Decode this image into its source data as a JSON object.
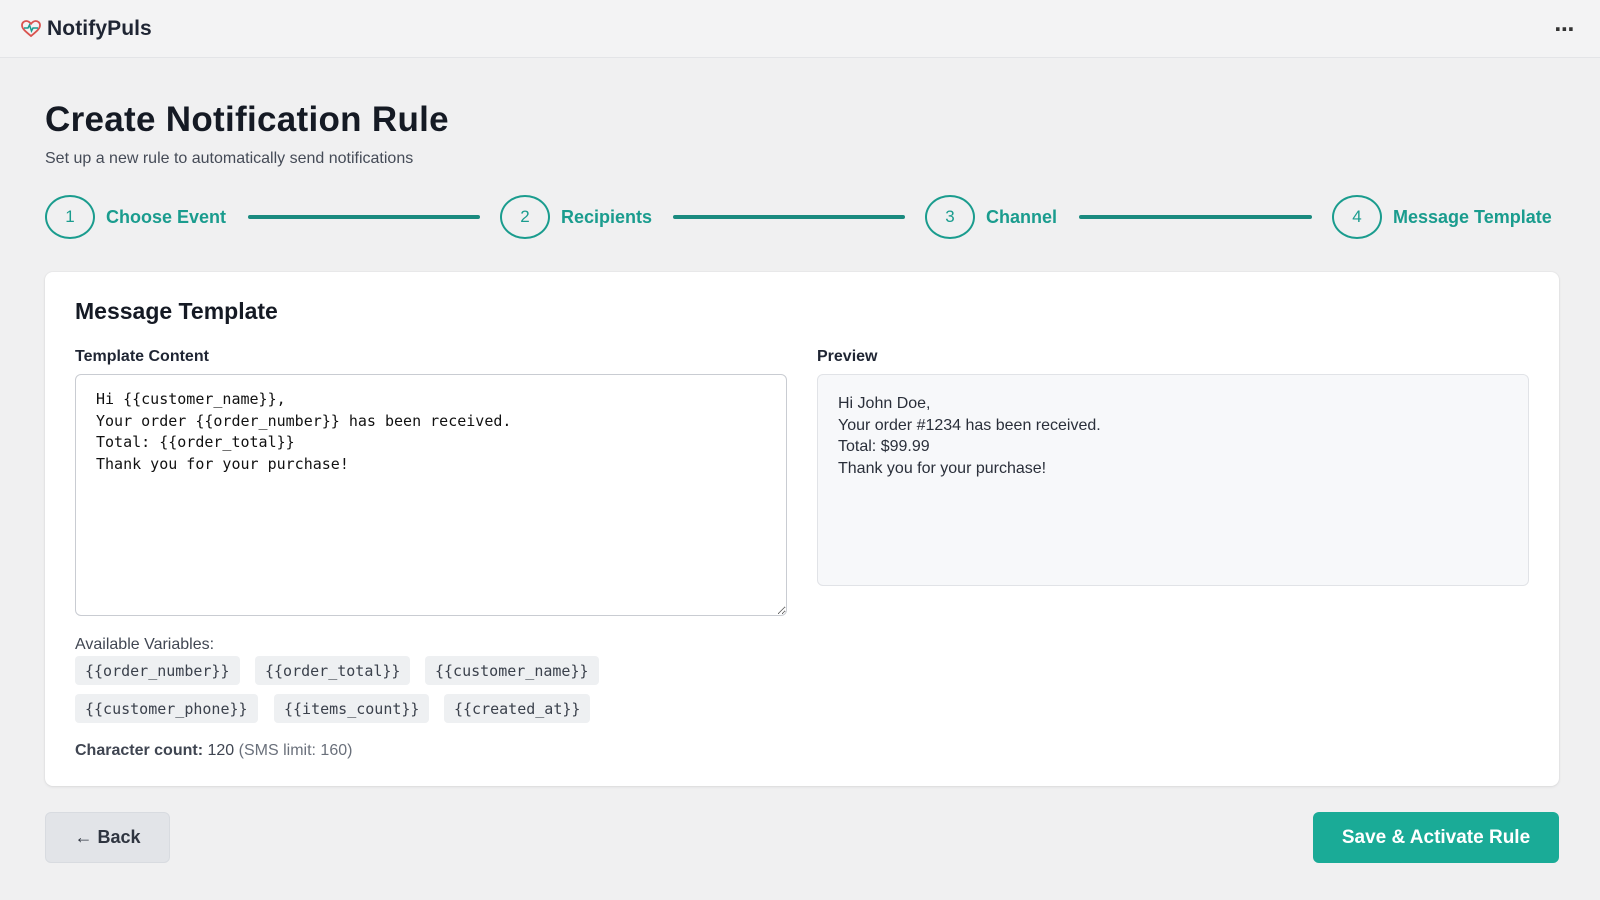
{
  "app": {
    "name": "NotifyPuls",
    "logo_icon": "heart-logo-icon",
    "menu_icon": "more-dots-icon",
    "menu_glyph": "⋯"
  },
  "header": {
    "title": "Create Notification Rule",
    "subtitle": "Set up a new rule to automatically send notifications"
  },
  "stepper": {
    "accent": "#1a9c8e",
    "steps": [
      {
        "number": "1",
        "label": "Choose Event"
      },
      {
        "number": "2",
        "label": "Recipients"
      },
      {
        "number": "3",
        "label": "Channel"
      },
      {
        "number": "4",
        "label": "Message Template"
      }
    ]
  },
  "card": {
    "title": "Message Template",
    "template_label": "Template Content",
    "template_value": "Hi {{customer_name}},\nYour order {{order_number}} has been received.\nTotal: {{order_total}}\nThank you for your purchase!",
    "preview_label": "Preview",
    "preview_lines": [
      "Hi John Doe,",
      "Your order #1234 has been received.",
      "Total: $99.99",
      "Thank you for your purchase!"
    ],
    "variables_label": "Available Variables:",
    "variables": [
      "{{order_number}}",
      "{{order_total}}",
      "{{customer_name}}",
      "{{customer_phone}}",
      "{{items_count}}",
      "{{created_at}}"
    ],
    "char_count_label": "Character count:",
    "char_count_value": "120",
    "char_count_limit": "(SMS limit: 160)"
  },
  "actions": {
    "back_label": "← Back",
    "save_label": "Save & Activate Rule",
    "save_color": "#1aab97"
  }
}
